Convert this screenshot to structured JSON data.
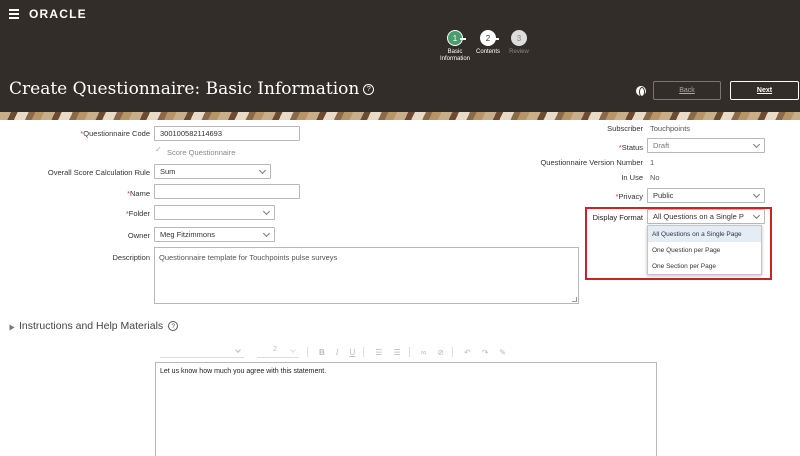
{
  "header": {
    "logo": "ORACLE",
    "title": "Create Questionnaire: Basic Information",
    "help_glyph": "?",
    "back_label": "Back",
    "next_label": "Next"
  },
  "train": {
    "steps": [
      {
        "number": "1",
        "label_line1": "Basic",
        "label_line2": "Information",
        "state": "current"
      },
      {
        "number": "2",
        "label_line1": "Contents",
        "label_line2": "",
        "state": "next"
      },
      {
        "number": "3",
        "label_line1": "Review",
        "label_line2": "",
        "state": "disabled"
      }
    ]
  },
  "form": {
    "code_label": "Questionnaire Code",
    "code_value": "300100582114693",
    "score_label": "Score Questionnaire",
    "calc_label": "Overall Score Calculation Rule",
    "calc_value": "Sum",
    "name_label": "Name",
    "name_value": "",
    "folder_label": "Folder",
    "folder_value": "",
    "owner_label": "Owner",
    "owner_value": "Meg Fitzimmons",
    "description_label": "Description",
    "description_value": "Questionnaire template for Touchpoints pulse surveys",
    "required_mark": "*"
  },
  "right_form": {
    "subscriber_label": "Subscriber",
    "subscriber_value": "Touchpoints",
    "status_label": "Status",
    "status_value": "Draft",
    "version_label": "Questionnaire Version Number",
    "version_value": "1",
    "in_use_label": "In Use",
    "in_use_value": "No",
    "privacy_label": "Privacy",
    "privacy_value": "Public",
    "display_label": "Display Format",
    "display_value": "All Questions on a Single P",
    "display_options": [
      "All Questions on a Single Page",
      "One Question per Page",
      "One Section per Page"
    ]
  },
  "instructions": {
    "title": "Instructions and Help Materials",
    "font_size": "2",
    "editor_text": "Let us know how much you agree with this statement."
  },
  "colors": {
    "header_bg": "#332d2a",
    "step_current": "#4a9b6e",
    "highlight": "#cc2222",
    "required": "#c74634"
  }
}
